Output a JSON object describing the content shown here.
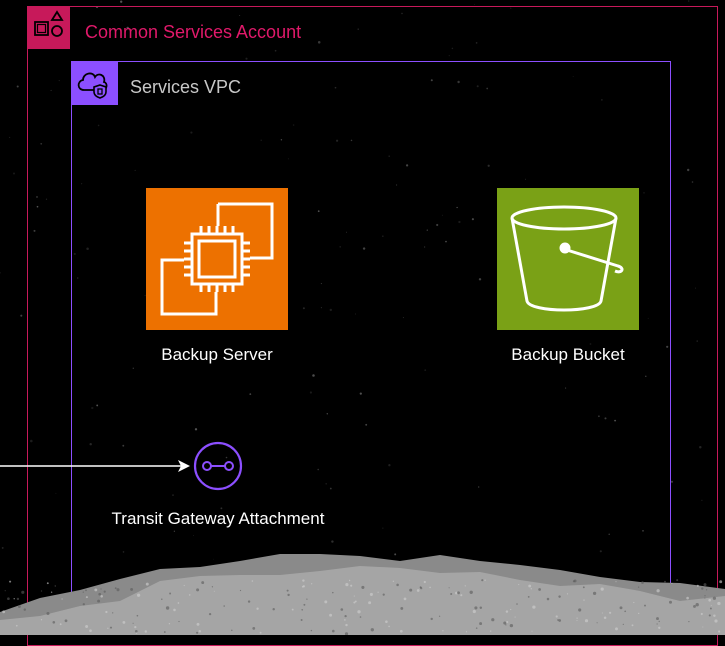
{
  "account": {
    "label": "Common Services Account",
    "icon": "account-icon",
    "color": "#c7195a"
  },
  "vpc": {
    "label": "Services VPC",
    "icon": "vpc-icon",
    "color": "#8c4fff"
  },
  "nodes": {
    "server": {
      "label": "Backup Server",
      "icon": "ec2-instance-icon",
      "color": "#ed7100"
    },
    "bucket": {
      "label": "Backup Bucket",
      "icon": "s3-bucket-icon",
      "color": "#7aa116"
    },
    "tgw": {
      "label": "Transit Gateway Attachment",
      "icon": "transit-gateway-attachment-icon",
      "color": "#8c4fff"
    }
  }
}
